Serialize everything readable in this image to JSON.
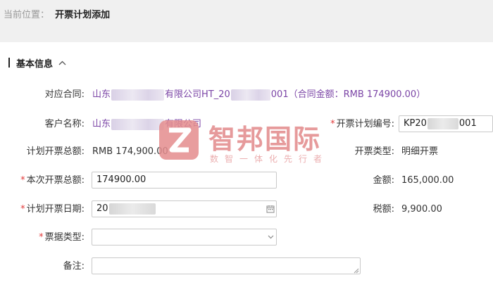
{
  "breadcrumb": {
    "prefix": "当前位置：",
    "current": "开票计划添加"
  },
  "section": {
    "title": "基本信息",
    "toggle_icon": "chevron-up-icon"
  },
  "fields": {
    "contract": {
      "label": "对应合同:",
      "value_prefix": "山东",
      "value_mid": "有限公司HT_20",
      "value_suffix": "001（合同金额：RMB 174900.00）"
    },
    "customer": {
      "label": "客户名称:",
      "value_prefix": "山东",
      "value_suffix": "有限公司"
    },
    "plan_no": {
      "required_mark": "*",
      "label": "开票计划编号:",
      "value_prefix": "KP20",
      "value_suffix": "001"
    },
    "plan_total": {
      "label": "计划开票总额:",
      "value": "RMB 174,900.00"
    },
    "invoice_type": {
      "label": "开票类型:",
      "value": "明细开票"
    },
    "current_total": {
      "required_mark": "*",
      "label": "本次开票总额:",
      "value": "174900.00"
    },
    "amount": {
      "label": "金额:",
      "value": "165,000.00"
    },
    "plan_date": {
      "required_mark": "*",
      "label": "计划开票日期:",
      "value_prefix": "20"
    },
    "tax": {
      "label": "税额:",
      "value": "9,900.00"
    },
    "bill_type": {
      "required_mark": "*",
      "label": "票据类型:",
      "value": ""
    },
    "remark": {
      "label": "备注:",
      "value": ""
    }
  },
  "watermark": {
    "text": "智邦国际",
    "sub": "数智一体化先行者"
  },
  "colors": {
    "accent_purple": "#7b45a6",
    "required_red": "#e23b3b",
    "watermark_red": "#e2898a"
  }
}
